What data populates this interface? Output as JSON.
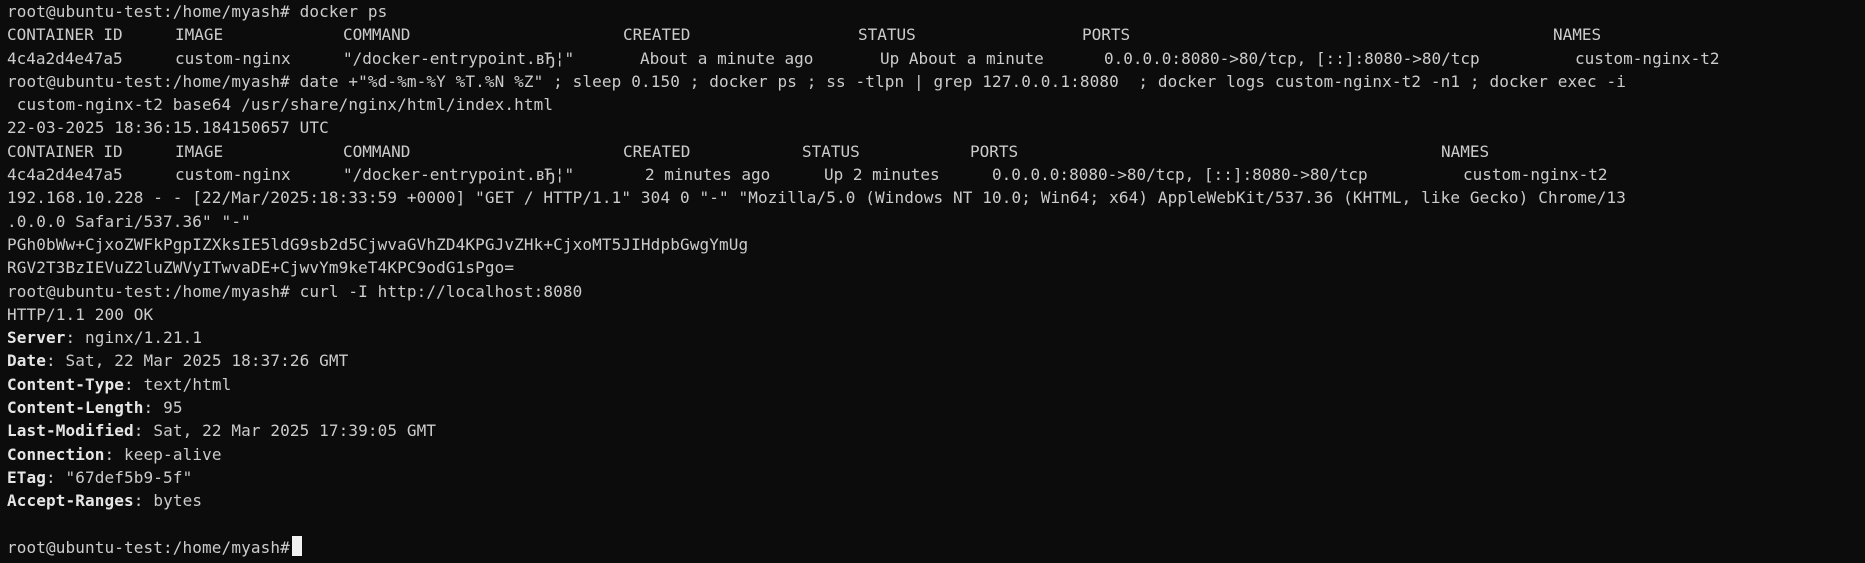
{
  "terminal": {
    "prompt": "root@ubuntu-test:/home/myash#",
    "lines": [
      {
        "type": "cmd",
        "text": " docker ps"
      }
    ],
    "ps1": {
      "headers": [
        "CONTAINER ID",
        "IMAGE",
        "COMMAND",
        "CREATED",
        "STATUS",
        "PORTS",
        "NAMES"
      ],
      "row": [
        "4c4a2d4e47a5",
        "custom-nginx",
        "\"/docker-entrypoint.вЂ¦\"",
        "About a minute ago",
        "Up About a minute",
        "0.0.0.0:8080->80/tcp, [::]:8080->80/tcp",
        "custom-nginx-t2"
      ]
    },
    "cmd2": " date +\"%d-%m-%Y %T.%N %Z\" ; sleep 0.150 ; docker ps ; ss -tlpn | grep 127.0.0.1:8080  ; docker logs custom-nginx-t2 -n1 ; docker exec -i",
    "cmd2_wrap": " custom-nginx-t2 base64 /usr/share/nginx/html/index.html",
    "date_out": "22-03-2025 18:36:15.184150657 UTC",
    "ps2": {
      "headers": [
        "CONTAINER ID",
        "IMAGE",
        "COMMAND",
        "CREATED",
        "STATUS",
        "PORTS",
        "NAMES"
      ],
      "row": [
        "4c4a2d4e47a5",
        "custom-nginx",
        "\"/docker-entrypoint.вЂ¦\"",
        "2 minutes ago",
        "Up 2 minutes",
        "0.0.0.0:8080->80/tcp, [::]:8080->80/tcp",
        "custom-nginx-t2"
      ]
    },
    "log_line": "192.168.10.228 - - [22/Mar/2025:18:33:59 +0000] \"GET / HTTP/1.1\" 304 0 \"-\" \"Mozilla/5.0 (Windows NT 10.0; Win64; x64) AppleWebKit/537.36 (KHTML, like Gecko) Chrome/13",
    "log_wrap": ".0.0.0 Safari/537.36\" \"-\"",
    "b64_1": "PGh0bWw+CjxoZWFkPgpIZXksIE5ldG9sb2d5CjwvaGVhZD4KPGJvZHk+CjxoMT5JIHdpbGwgYmUg",
    "b64_2": "RGV2T3BzIEVuZ2luZWVyITwvaDE+CjwvYm9keT4KPC9odG1sPgo=",
    "cmd3": " curl -I http://localhost:8080",
    "http_status": "HTTP/1.1 200 OK",
    "headers": [
      {
        "key": "Server",
        "value": " nginx/1.21.1"
      },
      {
        "key": "Date",
        "value": " Sat, 22 Mar 2025 18:37:26 GMT"
      },
      {
        "key": "Content-Type",
        "value": " text/html"
      },
      {
        "key": "Content-Length",
        "value": " 95"
      },
      {
        "key": "Last-Modified",
        "value": " Sat, 22 Mar 2025 17:39:05 GMT"
      },
      {
        "key": "Connection",
        "value": " keep-alive"
      },
      {
        "key": "ETag",
        "value": " \"67def5b9-5f\""
      },
      {
        "key": "Accept-Ranges",
        "value": " bytes"
      }
    ],
    "colon": ":"
  },
  "colors": {
    "background": "#0c0c0c",
    "foreground": "#cccccc",
    "cursor": "#f2f2f2"
  }
}
